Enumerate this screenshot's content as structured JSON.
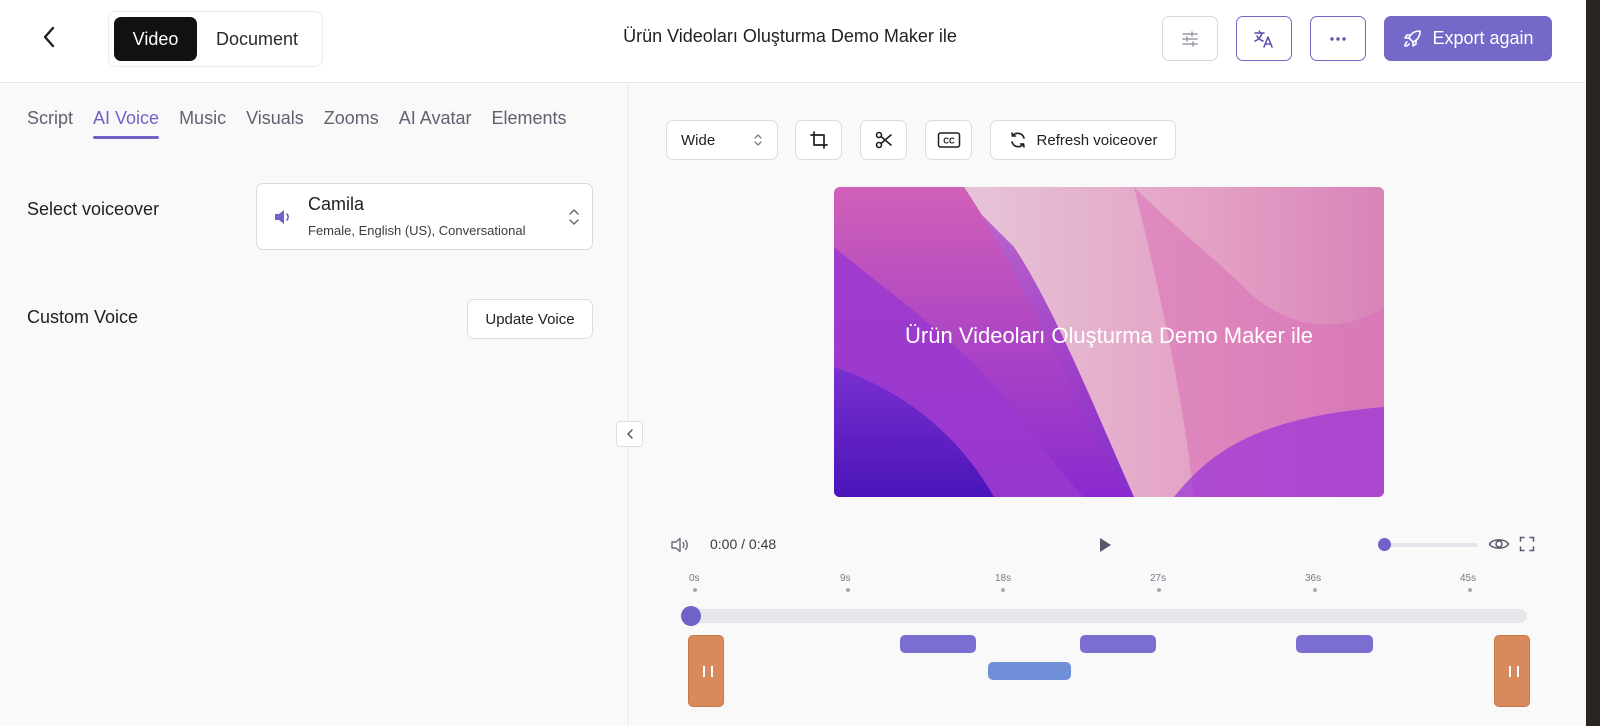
{
  "header": {
    "segments": [
      "Video",
      "Document"
    ],
    "title": "Ürün Videoları Oluşturma Demo Maker ile",
    "export_label": "Export again"
  },
  "tabs": [
    "Script",
    "AI Voice",
    "Music",
    "Visuals",
    "Zooms",
    "AI Avatar",
    "Elements"
  ],
  "active_tab": "AI Voice",
  "voice": {
    "label": "Select voiceover",
    "name": "Camila",
    "description": "Female, English (US), Conversational"
  },
  "custom_voice": {
    "label": "Custom Voice",
    "button": "Update Voice"
  },
  "toolbar": {
    "aspect": "Wide",
    "refresh_label": "Refresh voiceover"
  },
  "video": {
    "overlay_text": "Ürün Videoları Oluşturma Demo Maker ile"
  },
  "player": {
    "current": "0:00",
    "separator": "/",
    "duration": "0:48",
    "volume": 0.0,
    "progress": 0.0
  },
  "timeline": {
    "ticks": [
      "0s",
      "9s",
      "18s",
      "27s",
      "36s",
      "45s"
    ]
  },
  "colors": {
    "accent": "#6f62c9",
    "handle": "#d98a5c",
    "clip": "#7a6fd0"
  }
}
